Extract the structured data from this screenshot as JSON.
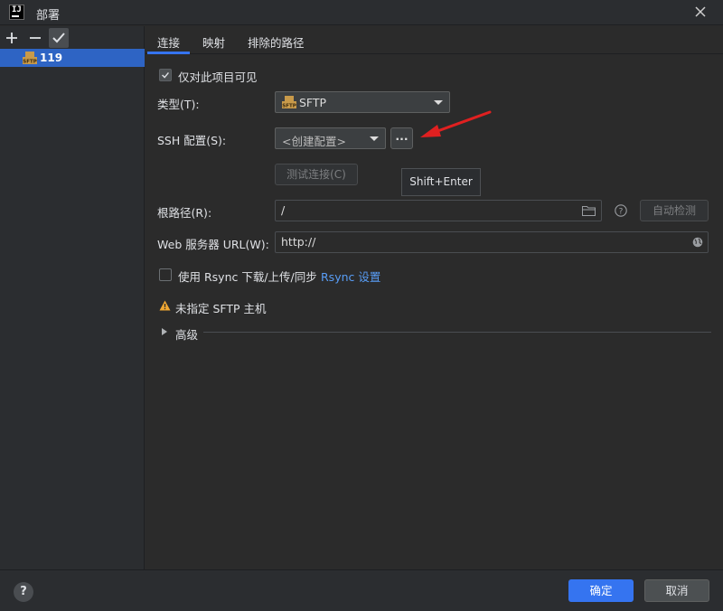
{
  "window": {
    "title": "部署"
  },
  "toolbar": {
    "add_icon": "plus-icon",
    "remove_icon": "minus-icon",
    "apply_icon": "check-icon"
  },
  "tree": {
    "items": [
      {
        "label": "119",
        "icon": "sftp-icon"
      }
    ]
  },
  "tabs": [
    {
      "label": "连接",
      "active": true
    },
    {
      "label": "映射"
    },
    {
      "label": "排除的路径"
    }
  ],
  "connection": {
    "visible_only_label": "仅对此项目可见",
    "visible_only_checked": true,
    "type_label": "类型(T):",
    "type_value": "SFTP",
    "ssh_label": "SSH 配置(S):",
    "ssh_placeholder": "<创建配置>",
    "ssh_more_label": "...",
    "test_button": "测试连接(C)",
    "tooltip": "Shift+Enter",
    "root_label": "根路径(R):",
    "root_value": "/",
    "autodetect_button": "自动检测",
    "web_url_label": "Web 服务器 URL(W):",
    "web_url_value": "http://",
    "rsync_label": "使用 Rsync 下载/上传/同步",
    "rsync_checked": false,
    "rsync_link": "Rsync 设置",
    "warning_text": "未指定 SFTP 主机",
    "advanced_label": "高级"
  },
  "footer": {
    "help": "?",
    "ok_label": "确定",
    "cancel_label": "取消"
  },
  "colors": {
    "accent": "#3574f0",
    "warning": "#f0a732",
    "annotation_arrow": "#e02020",
    "link": "#589df6"
  }
}
